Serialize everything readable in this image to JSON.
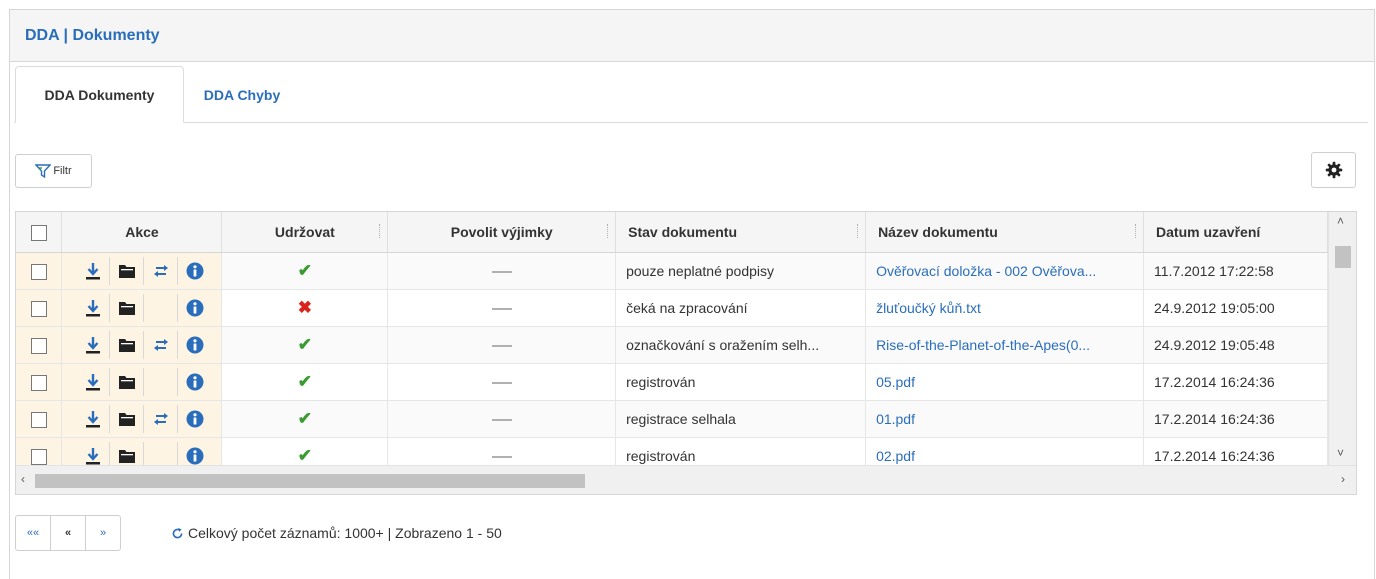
{
  "panel": {
    "title": "DDA | Dokumenty"
  },
  "tabs": [
    {
      "label": "DDA Dokumenty",
      "active": true
    },
    {
      "label": "DDA Chyby",
      "active": false
    }
  ],
  "toolbar": {
    "filter_label": "Filtr",
    "filter_icon": "filter-icon",
    "settings_icon": "gear-icon"
  },
  "table": {
    "headers": [
      "Akce",
      "Udržovat",
      "Povolit výjimky",
      "Stav dokumentu",
      "Název dokumentu",
      "Datum uzavření"
    ],
    "rows": [
      {
        "actions": [
          "download",
          "folder",
          "transfer",
          "info"
        ],
        "udrzovat": "check",
        "povolit": "dash",
        "stav": "pouze neplatné podpisy",
        "nazev": "Ověřovací doložka - 002 Ověřova...",
        "datum": "11.7.2012 17:22:58"
      },
      {
        "actions": [
          "download",
          "folder",
          "",
          "info"
        ],
        "udrzovat": "x",
        "povolit": "dash",
        "stav": "čeká na zpracování",
        "nazev": "žluťoučký kůň.txt",
        "datum": "24.9.2012 19:05:00"
      },
      {
        "actions": [
          "download",
          "folder",
          "transfer",
          "info"
        ],
        "udrzovat": "check",
        "povolit": "dash",
        "stav": "označkování s oražením selh...",
        "nazev": "Rise-of-the-Planet-of-the-Apes(0...",
        "datum": "24.9.2012 19:05:48"
      },
      {
        "actions": [
          "download",
          "folder",
          "",
          "info"
        ],
        "udrzovat": "check",
        "povolit": "dash",
        "stav": "registrován",
        "nazev": "05.pdf",
        "datum": "17.2.2014 16:24:36"
      },
      {
        "actions": [
          "download",
          "folder",
          "transfer",
          "info"
        ],
        "udrzovat": "check",
        "povolit": "dash",
        "stav": "registrace selhala",
        "nazev": "01.pdf",
        "datum": "17.2.2014 16:24:36"
      },
      {
        "actions": [
          "download",
          "folder",
          "",
          "info"
        ],
        "udrzovat": "check",
        "povolit": "dash",
        "stav": "registrován",
        "nazev": "02.pdf",
        "datum": "17.2.2014 16:24:36"
      }
    ]
  },
  "pager": {
    "first": "««",
    "prev": "«",
    "next": "»",
    "info": "Celkový počet záznamů: 1000+ | Zobrazeno 1 - 50"
  },
  "colors": {
    "accent": "#2a6ebb",
    "check": "#3a9b31",
    "error": "#d9231b",
    "action_bg": "#fdf4e3"
  }
}
